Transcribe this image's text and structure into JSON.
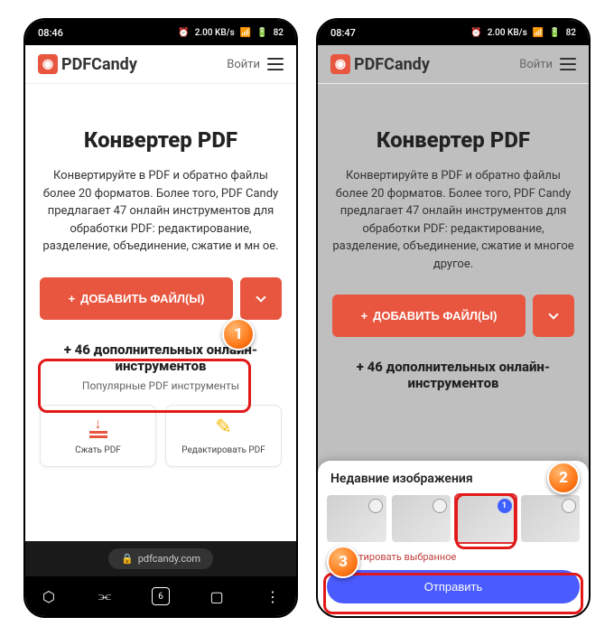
{
  "left": {
    "status": {
      "time": "08:46",
      "net": "2.00 KB/s",
      "batt": "82"
    }
  },
  "right": {
    "status": {
      "time": "08:47",
      "net": "2.00 KB/s",
      "batt": "82"
    }
  },
  "logo_text": "PDFCandy",
  "login_label": "Войти",
  "heading": "Конвертер PDF",
  "description": "Конвертируйте в PDF и обратно файлы более 20 форматов. Более того, PDF Candy предлагает 47 онлайн инструментов для обработки PDF: редактирование, разделение, объединение, сжатие и многое другое.",
  "description_clipped": "Конвертируйте в PDF и обратно файлы более 20 форматов. Более того, PDF Candy предлагает 47 онлайн инструментов для обработки PDF: редактирование, разделение, объединение, сжатие и мн           ое.",
  "add_button": "ДОБАВИТЬ ФАЙЛ(Ы)",
  "extra_tools_title": "+ 46 дополнительных онлайн-инструментов",
  "popular_label": "Популярные PDF инструменты",
  "tool_compress": "Сжать PDF",
  "tool_edit": "Редактировать PDF",
  "url": "pdfcandy.com",
  "tab_count": "6",
  "picker": {
    "title": "Недавние изображения",
    "selected_badge": "1",
    "edit_selected": "Редактировать выбранное",
    "send": "Отправить"
  },
  "callouts": {
    "c1": "1",
    "c2": "2",
    "c3": "3"
  }
}
